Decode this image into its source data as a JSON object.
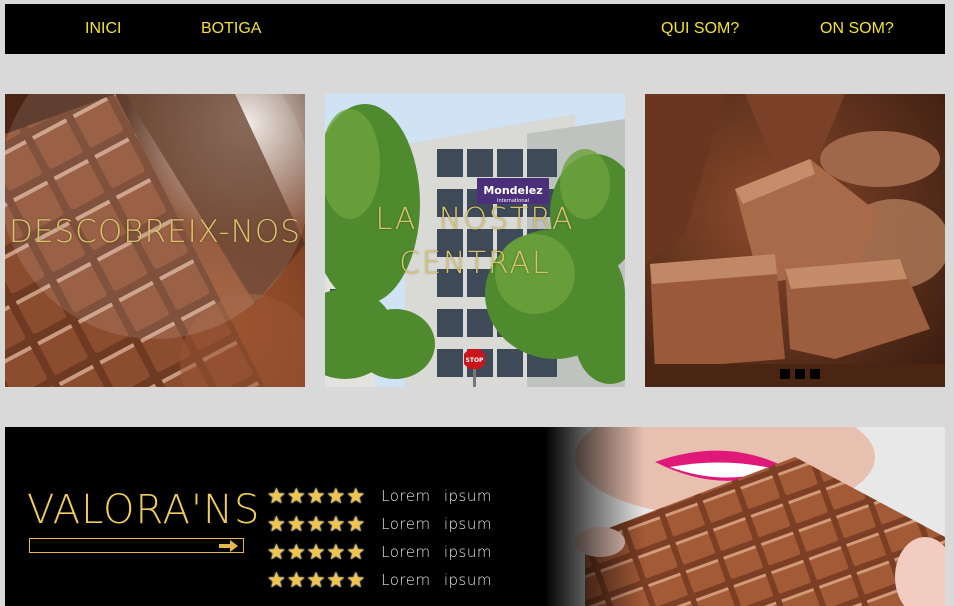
{
  "nav": {
    "items": [
      {
        "label": "INICI"
      },
      {
        "label": "BOTIGA"
      },
      {
        "label": "QUI SOM?"
      },
      {
        "label": "ON SOM?"
      }
    ]
  },
  "panels": [
    {
      "caption": "DESCOBREIX-NOS"
    },
    {
      "caption_line1": "LA NOSTRA",
      "caption_line2": "CENTRAL",
      "sign": "Mondelez",
      "sign_sub": "International",
      "stop": "STOP"
    },
    {
      "carousel_dots": 3
    }
  ],
  "rating": {
    "title": "VALORA'NS",
    "rows": [
      {
        "label": "Lorem ipsum",
        "stars": 5
      },
      {
        "label": "Lorem ipsum",
        "stars": 5
      },
      {
        "label": "Lorem ipsum",
        "stars": 5
      },
      {
        "label": "Lorem ipsum",
        "stars": 5
      }
    ]
  },
  "colors": {
    "nav_bg": "#000000",
    "nav_text": "#f3e330",
    "page_bg": "#d9d9d9",
    "accent_gold": "#f0cc5a"
  }
}
